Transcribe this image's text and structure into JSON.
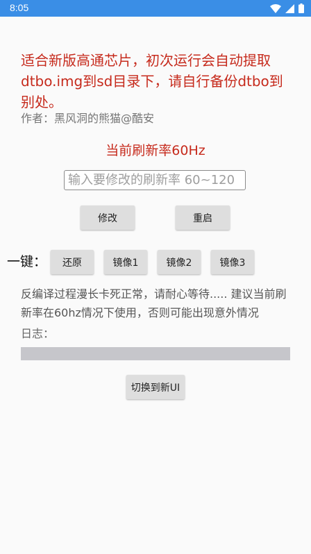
{
  "status_bar": {
    "time": "8:05",
    "icons": [
      "wifi-icon",
      "signal-icon",
      "battery-icon"
    ],
    "background_color": "#3a8ee6"
  },
  "notice": {
    "text": "适合新版高通芯片，初次运行会自动提取dtbo.img到sd目录下，请自行备份dtbo到别处。",
    "color": "#c62a1c"
  },
  "author": "作者：黑风洞的熊猫@酷安",
  "current_rate": "当前刷新率60Hz",
  "rate_input": {
    "value": "",
    "placeholder": "输入要修改的刷新率 60~120"
  },
  "buttons": {
    "modify": "修改",
    "reboot": "重启"
  },
  "onekey": {
    "label": "一键：",
    "restore": "还原",
    "image1": "镜像1",
    "image2": "镜像2",
    "image3": "镜像3"
  },
  "hint": "反编译过程漫长卡死正常，请耐心等待..... 建议当前刷新率在60hz情况下使用，否则可能出现意外情况",
  "log_label": "日志：",
  "switch_ui": "切换到新UI"
}
